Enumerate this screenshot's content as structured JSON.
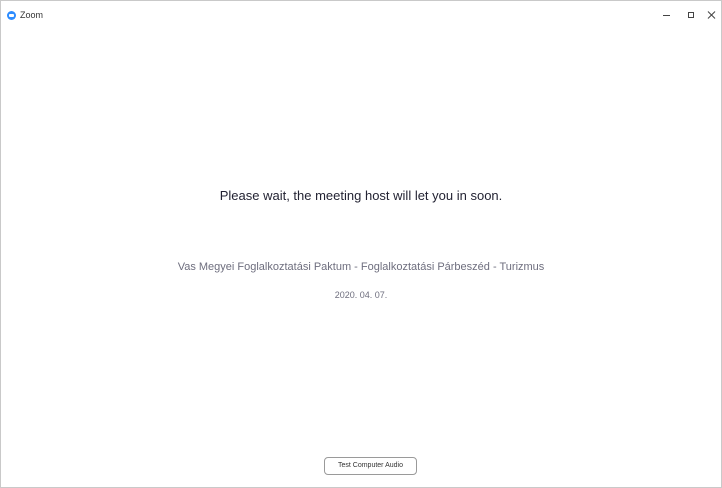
{
  "window": {
    "title": "Zoom",
    "app_icon": "zoom-logo-icon",
    "controls": {
      "minimize_icon": "minimize-icon",
      "maximize_icon": "maximize-icon",
      "close_icon": "close-icon"
    }
  },
  "waiting_room": {
    "message": "Please wait, the meeting host will let you in soon.",
    "meeting_topic": "Vas Megyei Foglalkoztatási Paktum - Foglalkoztatási Párbeszéd - Turizmus",
    "meeting_date": "2020. 04. 07."
  },
  "footer": {
    "test_audio_label": "Test Computer Audio"
  },
  "colors": {
    "accent": "#2d8cff",
    "primary_text": "#232333",
    "secondary_text": "#6e6e7e"
  }
}
